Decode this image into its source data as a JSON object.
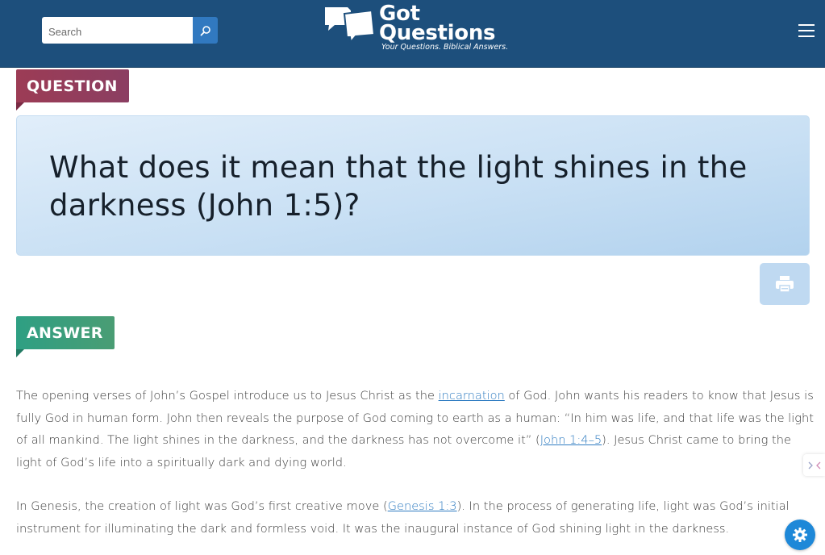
{
  "header": {
    "search": {
      "placeholder": "Search",
      "value": ""
    },
    "logo": {
      "word1": "Got",
      "word2": "Questions",
      "tagline": "Your Questions. Biblical Answers."
    },
    "colors": {
      "header_bg": "#1d4f7c",
      "search_button": "#3179c0"
    }
  },
  "question": {
    "label": "QUESTION",
    "title": "What does it mean that the light shines in the darkness (John 1:5)?"
  },
  "answer": {
    "label": "ANSWER",
    "p1": {
      "t1": "The opening verses of John’s Gospel introduce us to Jesus Christ as the ",
      "link1": "incarnation",
      "t2": " of God. John wants his readers to know that Jesus is fully God in human form. John then reveals the purpose of God coming to earth as a human: “In him was life, and that life was the light of all mankind. The light shines in the darkness, and the darkness has not overcome it” (",
      "link2": "John 1:4–5",
      "t3": "). Jesus Christ came to bring the light of God’s life into a spiritually dark and dying world."
    },
    "p2": {
      "t1": "In Genesis, the creation of light was God’s first creative move (",
      "link1": "Genesis 1:3",
      "t2": "). In the process of generating life, light was God’s initial instrument for illuminating the dark and formless void. It was the inaugural instance of God shining light in the darkness."
    }
  },
  "icons": {
    "search": "search-icon",
    "menu": "hamburger-menu-icon",
    "print": "printer-icon",
    "settings": "gear-icon",
    "side_widget": "shrink-arrows-icon"
  }
}
